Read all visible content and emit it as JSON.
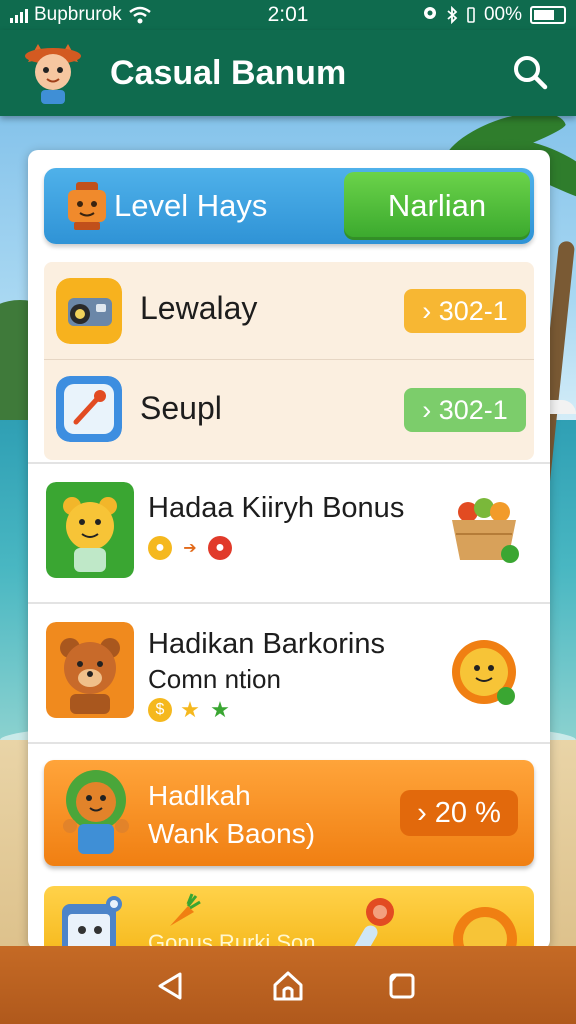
{
  "status_bar": {
    "carrier": "Bupbrurok",
    "time": "2:01",
    "battery_text": "00%"
  },
  "app_bar": {
    "title": "Casual Banum",
    "logo_icon": "fox-mascot-icon",
    "search_icon": "search-icon"
  },
  "hero": {
    "label": "Level Hays",
    "button_label": "Narlian",
    "icon": "robot-icon"
  },
  "rows": [
    {
      "label": "Lewalay",
      "pill": "› 302-1",
      "icon": "camera-icon",
      "pill_color": "#f7b733"
    },
    {
      "label": "Seupl",
      "pill": "› 302-1",
      "icon": "target-icon",
      "pill_color": "#7ccd6b"
    }
  ],
  "bonuses": [
    {
      "title": "Hadaa Kiiryh Bonus",
      "subtitle": "",
      "icon": "bear-mascot-icon",
      "reward_icon": "fruit-basket-icon"
    },
    {
      "title": "Hadikan Barkorins",
      "subtitle": "Comn ntion",
      "icon": "bear-mascot-icon",
      "reward_icon": "smiley-badge-icon"
    }
  ],
  "promo": {
    "title": "Hadlkah",
    "subtitle": "Wank Baons)",
    "badge": "› 20 %",
    "icon": "lion-mascot-icon"
  },
  "promo2": {
    "label": "Gonus Rurki Son",
    "icon": "calendar-icon"
  },
  "nav": {
    "back_icon": "back-triangle-icon",
    "home_icon": "home-icon",
    "recents_icon": "recents-square-icon"
  },
  "colors": {
    "primary_green": "#0f6b4e",
    "accent_blue": "#2f93d6",
    "accent_orange": "#f07f12",
    "nav_brown": "#b0591c"
  }
}
